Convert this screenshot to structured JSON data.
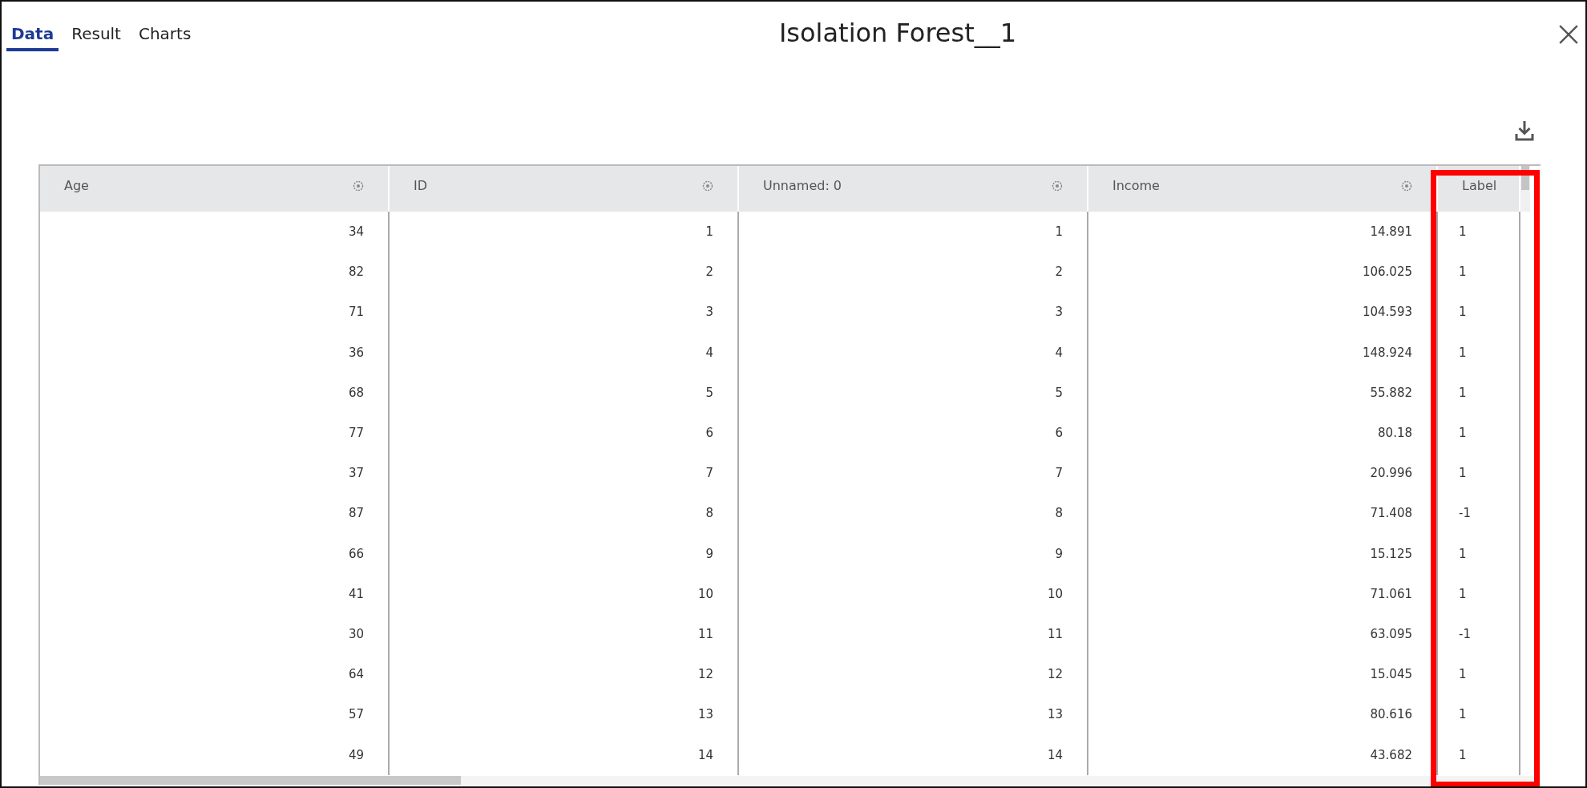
{
  "tabs": [
    {
      "label": "Data",
      "selected": true
    },
    {
      "label": "Result",
      "selected": false
    },
    {
      "label": "Charts",
      "selected": false
    }
  ],
  "title": "Isolation Forest__1",
  "table": {
    "columns": [
      {
        "name": "Age",
        "kind": "numeric"
      },
      {
        "name": "ID",
        "kind": "numeric"
      },
      {
        "name": "Unnamed: 0",
        "kind": "numeric"
      },
      {
        "name": "Income",
        "kind": "numeric"
      },
      {
        "name": "Label",
        "kind": "label"
      }
    ],
    "rows": [
      [
        "34",
        "1",
        "1",
        "14.891",
        "1"
      ],
      [
        "82",
        "2",
        "2",
        "106.025",
        "1"
      ],
      [
        "71",
        "3",
        "3",
        "104.593",
        "1"
      ],
      [
        "36",
        "4",
        "4",
        "148.924",
        "1"
      ],
      [
        "68",
        "5",
        "5",
        "55.882",
        "1"
      ],
      [
        "77",
        "6",
        "6",
        "80.18",
        "1"
      ],
      [
        "37",
        "7",
        "7",
        "20.996",
        "1"
      ],
      [
        "87",
        "8",
        "8",
        "71.408",
        "-1"
      ],
      [
        "66",
        "9",
        "9",
        "15.125",
        "1"
      ],
      [
        "41",
        "10",
        "10",
        "71.061",
        "1"
      ],
      [
        "30",
        "11",
        "11",
        "63.095",
        "-1"
      ],
      [
        "64",
        "12",
        "12",
        "15.045",
        "1"
      ],
      [
        "57",
        "13",
        "13",
        "80.616",
        "1"
      ],
      [
        "49",
        "14",
        "14",
        "43.682",
        "1"
      ]
    ]
  },
  "annotation": {
    "kind": "highlight_box",
    "color": "#ff0000"
  }
}
